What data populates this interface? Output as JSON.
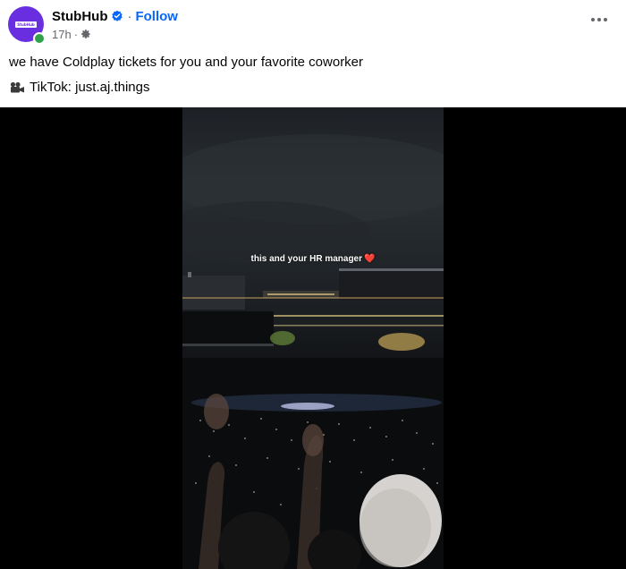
{
  "post": {
    "author": "StubHub",
    "follow_label": "Follow",
    "separator": "·",
    "time": "17h",
    "time_separator": "·",
    "caption": "we have Coldplay tickets for you and your favorite coworker",
    "credit": "TikTok: just.aj.things",
    "avatar_logo_text": "StubHub"
  },
  "video": {
    "overlay_text": "this and your HR manager",
    "overlay_emoji": "❤️"
  },
  "icons": {
    "verified": "verified-badge-icon",
    "privacy": "gear-icon",
    "more": "more-options-icon",
    "camera": "video-camera-icon"
  },
  "colors": {
    "accent": "#0866ff",
    "avatar_bg": "#6a2ee1",
    "online": "#31a24c",
    "secondary_text": "#65676b"
  }
}
